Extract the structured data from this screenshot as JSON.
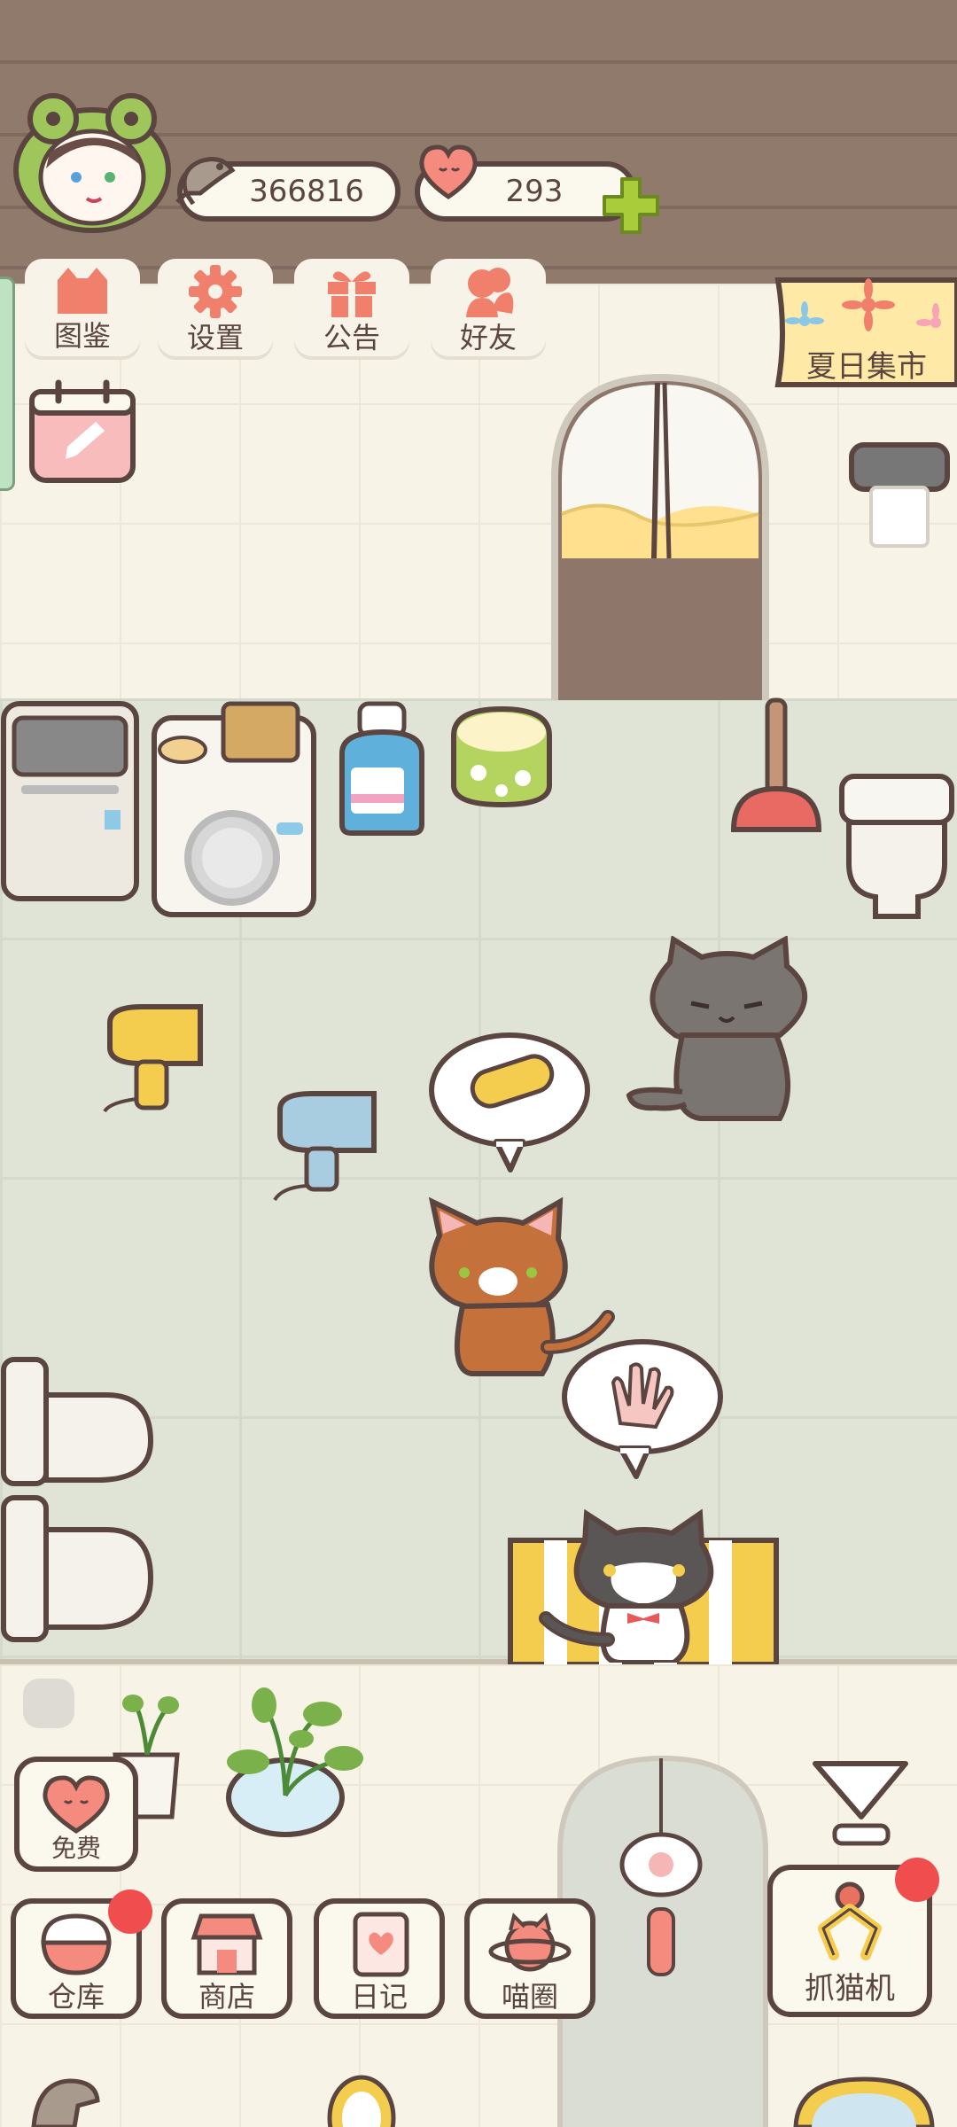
{
  "header": {
    "currency_fish": "366816",
    "currency_hearts": "293",
    "plus_icon": "plus-icon"
  },
  "menu": {
    "items": [
      {
        "label": "图鉴",
        "icon": "cat-book-icon"
      },
      {
        "label": "设置",
        "icon": "gear-icon"
      },
      {
        "label": "公告",
        "icon": "gift-icon"
      },
      {
        "label": "好友",
        "icon": "friends-icon"
      }
    ],
    "calendar_icon": "calendar-edit-icon"
  },
  "event": {
    "label": "夏日集市"
  },
  "speech": {
    "bubble1_icon": "brush-icon",
    "bubble2_icon": "hand-icon"
  },
  "bottom": {
    "free_label": "免费",
    "items": [
      {
        "label": "仓库",
        "icon": "rice-bowl-icon",
        "badge": true
      },
      {
        "label": "商店",
        "icon": "shop-icon",
        "badge": false
      },
      {
        "label": "日记",
        "icon": "diary-icon",
        "badge": false
      },
      {
        "label": "喵圈",
        "icon": "cat-planet-icon",
        "badge": false
      }
    ],
    "claw_label": "抓猫机",
    "claw_badge": true
  },
  "colors": {
    "accent_orange": "#f07f6c",
    "ink": "#5b4540",
    "badge_red": "#f04e4e",
    "plus_green": "#a9cc3b"
  }
}
